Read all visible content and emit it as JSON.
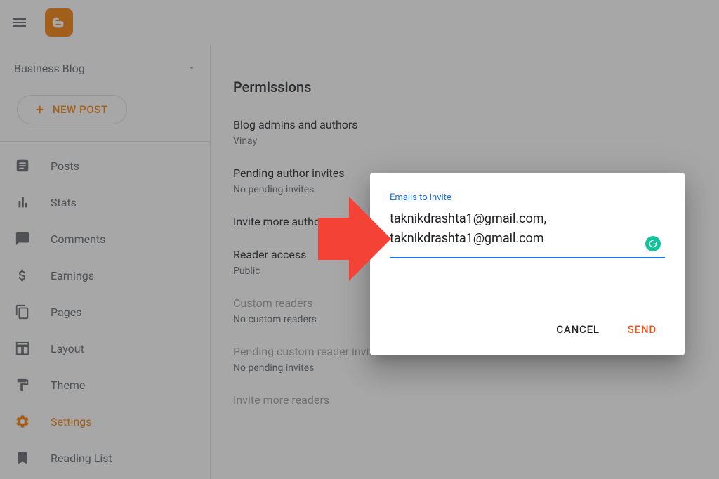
{
  "header": {
    "blog_name": "Business Blog"
  },
  "sidebar": {
    "new_post_label": "NEW POST",
    "items": [
      {
        "label": "Posts"
      },
      {
        "label": "Stats"
      },
      {
        "label": "Comments"
      },
      {
        "label": "Earnings"
      },
      {
        "label": "Pages"
      },
      {
        "label": "Layout"
      },
      {
        "label": "Theme"
      },
      {
        "label": "Settings"
      },
      {
        "label": "Reading List"
      }
    ]
  },
  "main": {
    "section_title": "Permissions",
    "items": [
      {
        "label": "Blog admins and authors",
        "value": "Vinay"
      },
      {
        "label": "Pending author invites",
        "value": "No pending invites"
      },
      {
        "label": "Invite more authors",
        "value": ""
      },
      {
        "label": "Reader access",
        "value": "Public"
      },
      {
        "label": "Custom readers",
        "value": "No custom readers"
      },
      {
        "label": "Pending custom reader invites",
        "value": "No pending invites"
      },
      {
        "label": "Invite more readers",
        "value": ""
      }
    ]
  },
  "dialog": {
    "label": "Emails to invite",
    "value": "taknikdrashta1@gmail.com, taknikdrashta1@gmail.com",
    "cancel_label": "CANCEL",
    "send_label": "SEND"
  }
}
